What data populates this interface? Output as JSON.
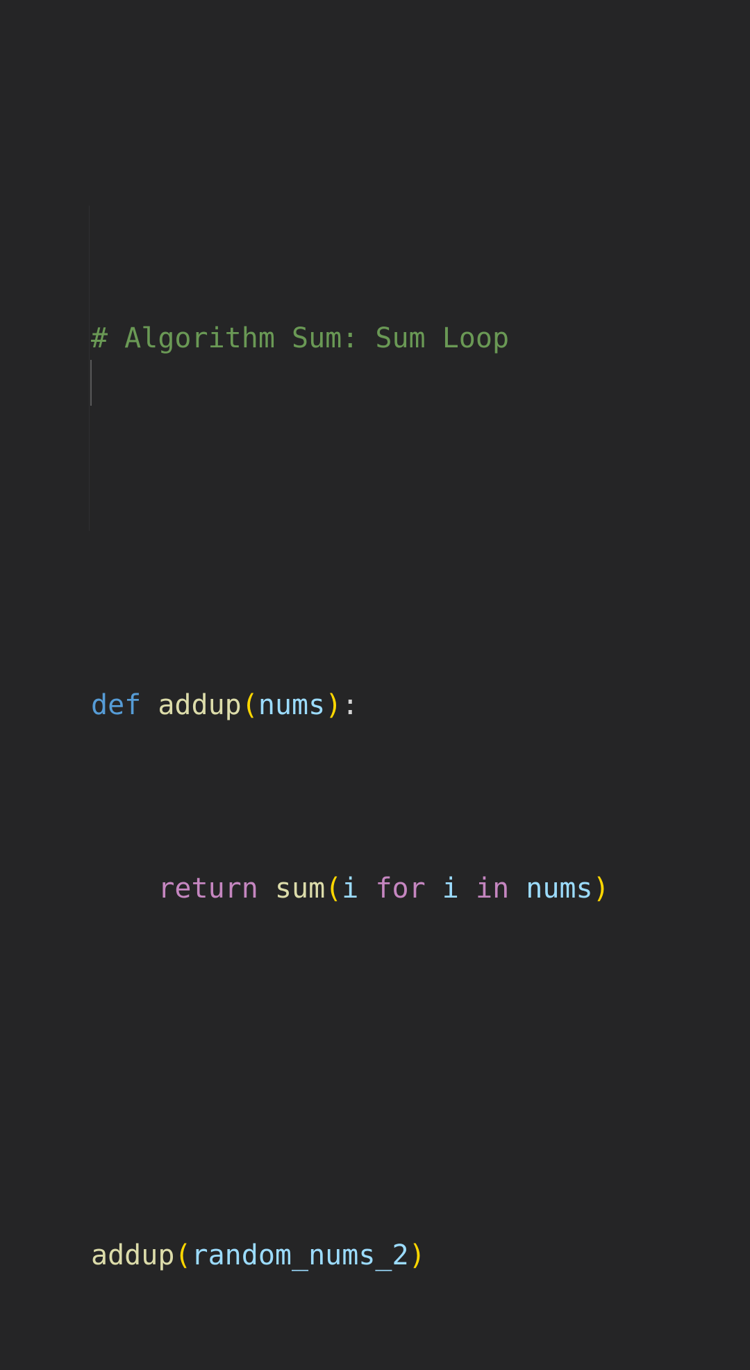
{
  "colors": {
    "background": "#252526",
    "comment": "#6a9955",
    "keyword_def": "#569cd6",
    "keyword_control": "#c586c0",
    "function": "#dcdcaa",
    "variable": "#9cdcfe",
    "bracket": "#ffd700",
    "punctuation": "#d4d4d4"
  },
  "code": {
    "line1": {
      "comment": "# Algorithm Sum: Sum Loop"
    },
    "line3": {
      "kw_def": "def",
      "sp1": " ",
      "fn_name": "addup",
      "paren_open": "(",
      "param": "nums",
      "paren_close": ")",
      "colon": ":"
    },
    "line4": {
      "indent": "    ",
      "kw_return": "return",
      "sp1": " ",
      "fn_sum": "sum",
      "paren_open": "(",
      "var_i1": "i",
      "sp2": " ",
      "kw_for": "for",
      "sp3": " ",
      "var_i2": "i",
      "sp4": " ",
      "kw_in": "in",
      "sp5": " ",
      "var_nums": "nums",
      "paren_close": ")"
    },
    "line6": {
      "fn_call": "addup",
      "paren_open": "(",
      "arg": "random_nums_2",
      "paren_close": ")"
    }
  }
}
